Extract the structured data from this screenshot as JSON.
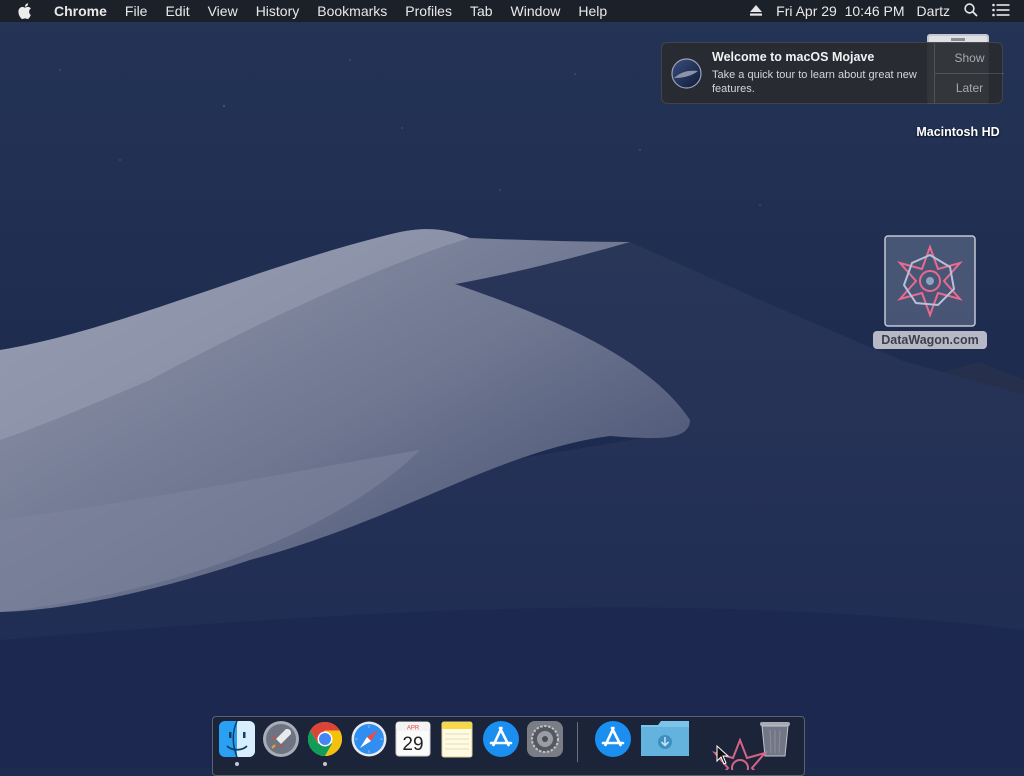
{
  "menubar": {
    "app_name": "Chrome",
    "items": [
      "File",
      "Edit",
      "View",
      "History",
      "Bookmarks",
      "Profiles",
      "Tab",
      "Window",
      "Help"
    ],
    "clock": "Fri Apr 29  10:46 PM",
    "user": "Dartz"
  },
  "notification": {
    "title": "Welcome to macOS Mojave",
    "body": "Take a quick tour to learn about great new features.",
    "show_label": "Show",
    "later_label": "Later"
  },
  "desktop": {
    "hd_label": "Macintosh HD",
    "datawagon_label": "DataWagon.com"
  },
  "dock": {
    "calendar_month": "APR",
    "calendar_day": "29",
    "items": [
      "Finder",
      "Launchpad",
      "Google Chrome",
      "Safari",
      "Calendar",
      "Notes",
      "App Store",
      "System Preferences",
      "App Store",
      "Downloads",
      "Trash"
    ]
  },
  "colors": {
    "sky": "#1f2d52",
    "dune": "#8d93a8",
    "menubar": "#1c1e24",
    "accent_blue": "#1b8ff0"
  }
}
